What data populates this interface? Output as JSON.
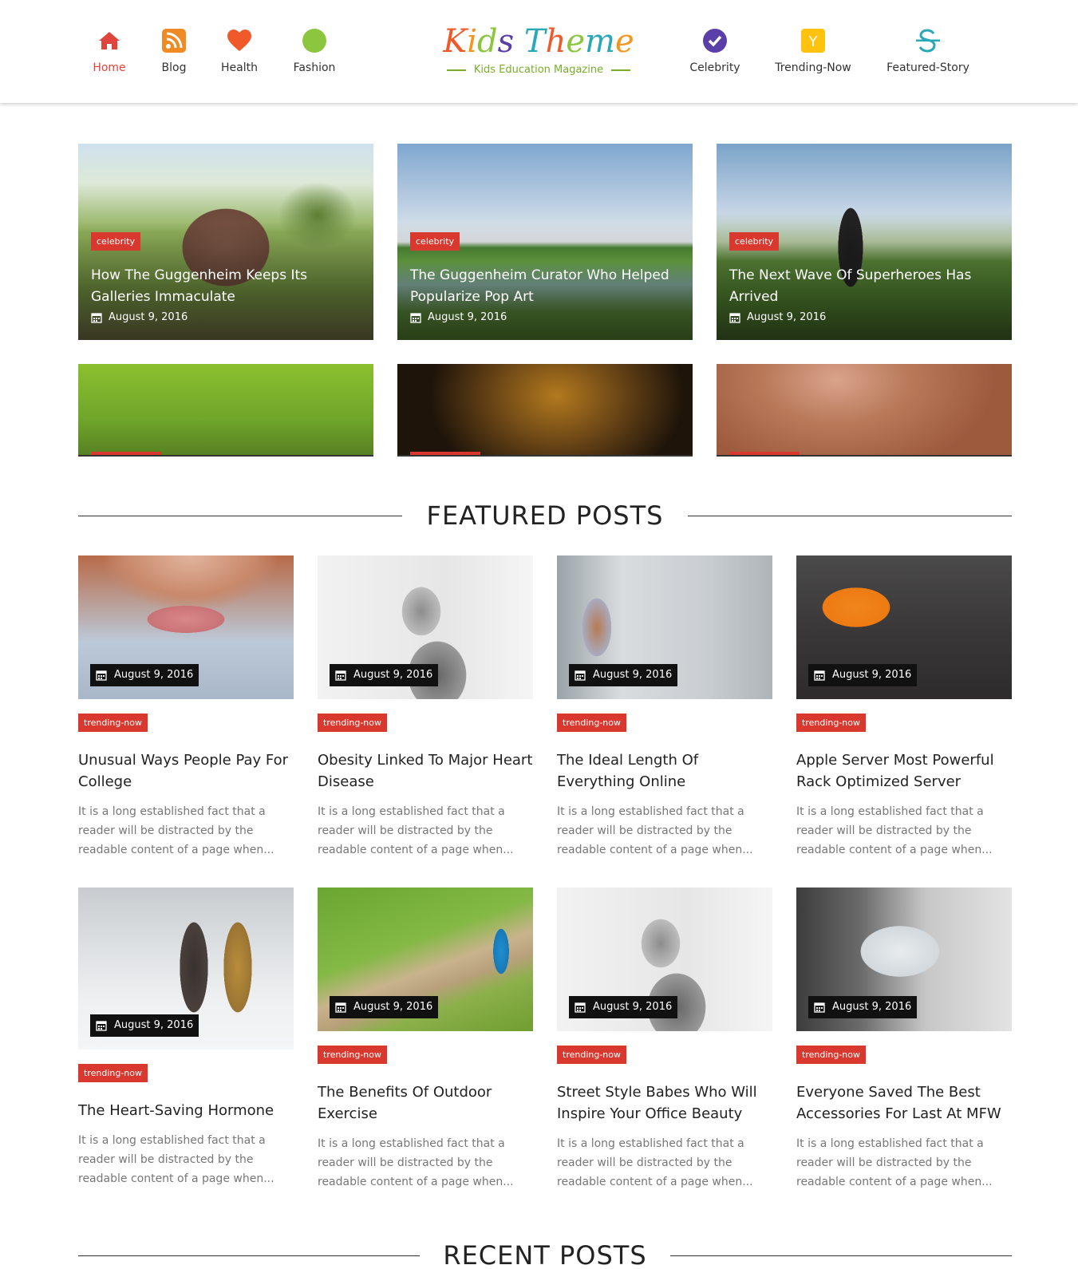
{
  "nav_left": [
    {
      "label": "Home",
      "icon": "home-icon",
      "color": "#e0443a",
      "active": true
    },
    {
      "label": "Blog",
      "icon": "rss-icon",
      "color": "#f08a24"
    },
    {
      "label": "Health",
      "icon": "heart-icon",
      "color": "#f05a2a"
    },
    {
      "label": "Fashion",
      "icon": "circle-icon",
      "color": "#8cc63f"
    }
  ],
  "nav_right": [
    {
      "label": "Celebrity",
      "icon": "check-circle-icon",
      "color": "#5b3fa8"
    },
    {
      "label": "Trending-Now",
      "icon": "y-square-icon",
      "color": "#ffc20e"
    },
    {
      "label": "Featured-Story",
      "icon": "strikethrough-icon",
      "color": "#2aa8b8"
    }
  ],
  "logo": {
    "title": "Kids Theme",
    "subtitle": "Kids Education Magazine"
  },
  "slider": [
    {
      "category": "celebrity",
      "title": "How The Guggenheim Keeps Its Galleries Immaculate",
      "date": "August 9, 2016"
    },
    {
      "category": "celebrity",
      "title": "The Guggenheim Curator Who Helped Popularize Pop Art",
      "date": "August 9, 2016"
    },
    {
      "category": "celebrity",
      "title": "The Next Wave Of Superheroes Has Arrived",
      "date": "August 9, 2016"
    }
  ],
  "featured": {
    "heading": "FEATURED POSTS",
    "posts": [
      {
        "category": "trending-now",
        "title": "Unusual Ways People Pay For College",
        "date": "August 9, 2016",
        "excerpt": "It is a long established fact that a reader will be distracted by the readable content of a page when..."
      },
      {
        "category": "trending-now",
        "title": "Obesity Linked To Major Heart Disease",
        "date": "August 9, 2016",
        "excerpt": "It is a long established fact that a reader will be distracted by the readable content of a page when..."
      },
      {
        "category": "trending-now",
        "title": "The Ideal Length Of Everything Online",
        "date": "August 9, 2016",
        "excerpt": "It is a long established fact that a reader will be distracted by the readable content of a page when..."
      },
      {
        "category": "trending-now",
        "title": "Apple Server Most Powerful Rack Optimized Server",
        "date": "August 9, 2016",
        "excerpt": "It is a long established fact that a reader will be distracted by the readable content of a page when..."
      },
      {
        "category": "trending-now",
        "title": "The Heart-Saving Hormone",
        "date": "August 9, 2016",
        "excerpt": "It is a long established fact that a reader will be distracted by the readable content of a page when..."
      },
      {
        "category": "trending-now",
        "title": "The Benefits Of Outdoor Exercise",
        "date": "August 9, 2016",
        "excerpt": "It is a long established fact that a reader will be distracted by the readable content of a page when..."
      },
      {
        "category": "trending-now",
        "title": "Street Style Babes Who Will Inspire Your Office Beauty",
        "date": "August 9, 2016",
        "excerpt": "It is a long established fact that a reader will be distracted by the readable content of a page when..."
      },
      {
        "category": "trending-now",
        "title": "Everyone Saved The Best Accessories For Last At MFW",
        "date": "August 9, 2016",
        "excerpt": "It is a long established fact that a reader will be distracted by the readable content of a page when..."
      }
    ]
  },
  "recent": {
    "heading": "RECENT POSTS"
  },
  "colors": {
    "accent": "#d9382e",
    "logo_green": "#7aac2c"
  }
}
